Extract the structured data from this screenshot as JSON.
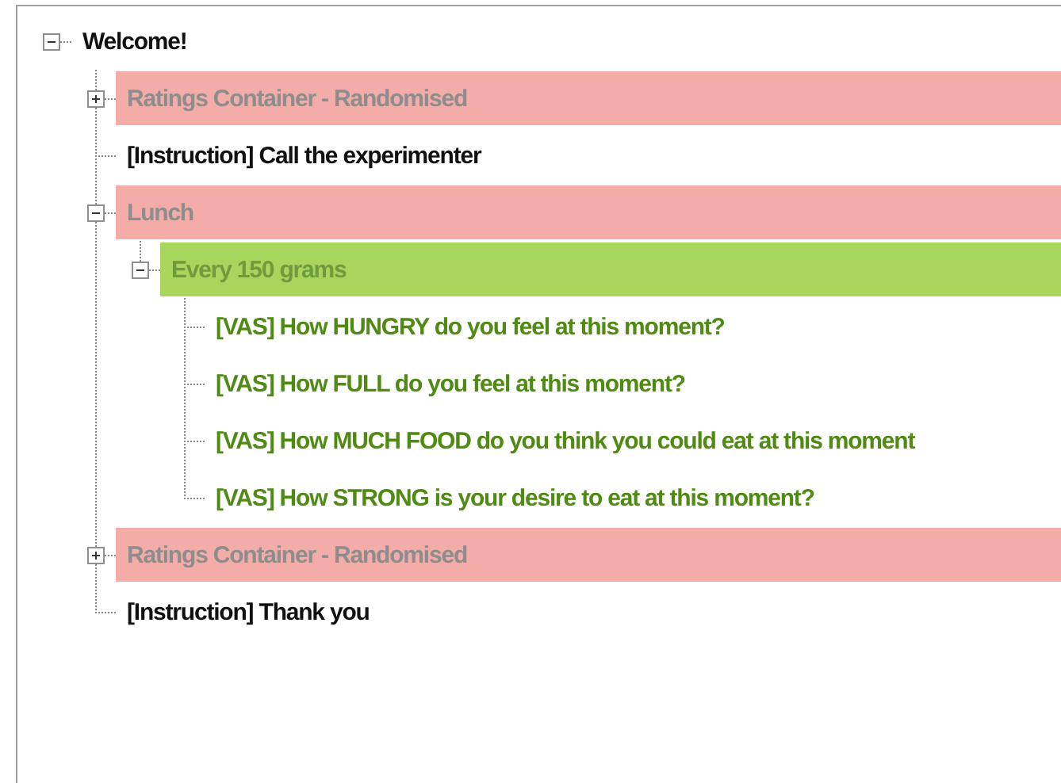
{
  "tree": [
    {
      "label": "Welcome!",
      "kind": "instruction",
      "expanded": true,
      "children": [
        {
          "label": "Ratings Container - Randomised",
          "kind": "container",
          "color": "#f4aca8",
          "expanded": false
        },
        {
          "label": "[Instruction] Call the experimenter",
          "kind": "instruction"
        },
        {
          "label": "Lunch",
          "kind": "container",
          "color": "#f4aca8",
          "expanded": true,
          "children": [
            {
              "label": "Every 150 grams",
              "kind": "group",
              "color": "#a8d65c",
              "expanded": true,
              "children": [
                {
                  "label": "[VAS] How HUNGRY do you feel at this moment?",
                  "kind": "vas"
                },
                {
                  "label": "[VAS] How FULL do you feel at this moment?",
                  "kind": "vas"
                },
                {
                  "label": "[VAS] How MUCH FOOD do you think you could eat at this moment",
                  "kind": "vas"
                },
                {
                  "label": "[VAS] How STRONG is your desire to eat at this moment?",
                  "kind": "vas"
                }
              ]
            }
          ]
        },
        {
          "label": "Ratings Container - Randomised",
          "kind": "container",
          "color": "#f4aca8",
          "expanded": false
        },
        {
          "label": "[Instruction] Thank you",
          "kind": "instruction"
        }
      ]
    }
  ]
}
